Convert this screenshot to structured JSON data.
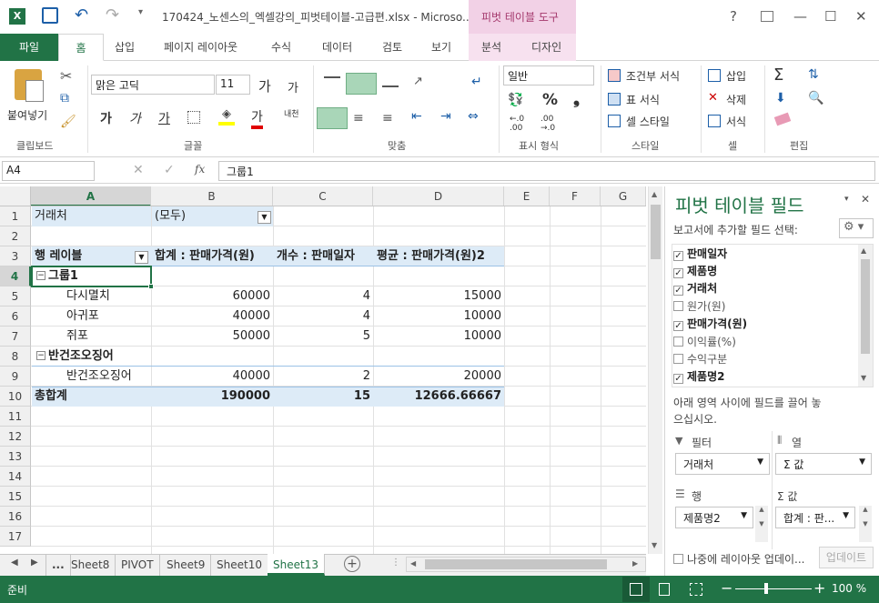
{
  "titlebar": {
    "title": "170424_노센스의_엑셀강의_피벗테이블-고급편.xlsx - Microso...",
    "context_group": "피벗 테이블 도구",
    "help": "?",
    "minimize": "—",
    "maximize": "☐",
    "close": "✕"
  },
  "ribbon_tabs": [
    "파일",
    "홈",
    "삽입",
    "페이지 레이아웃",
    "수식",
    "데이터",
    "검토",
    "보기",
    "분석",
    "디자인"
  ],
  "ribbon": {
    "clipboard": {
      "paste": "붙여넣기",
      "group": "클립보드"
    },
    "font": {
      "name": "맑은 고딕",
      "size": "11",
      "bold": "가",
      "italic": "가",
      "underline": "가",
      "grow": "가",
      "shrink": "가",
      "fontcolor": "가",
      "group": "글꼴",
      "phonetic": "내천"
    },
    "align": {
      "group": "맞춤"
    },
    "number": {
      "format": "일반",
      "group": "표시 형식",
      "percent": "%",
      "comma": "❟",
      "inc": "←.0\n.00",
      "dec": ".00\n→.0"
    },
    "styles": {
      "conditional": "조건부 서식",
      "table": "표 서식",
      "cell": "셀 스타일",
      "group": "스타일"
    },
    "cells": {
      "insert": "삽입",
      "delete": "삭제",
      "format": "서식",
      "group": "셀"
    },
    "editing": {
      "group": "편집"
    }
  },
  "formula_bar": {
    "name_box": "A4",
    "fx": "fx",
    "content": "그룹1"
  },
  "columns": [
    "A",
    "B",
    "C",
    "D",
    "E",
    "F",
    "G"
  ],
  "rows": [
    "1",
    "2",
    "3",
    "4",
    "5",
    "6",
    "7",
    "8",
    "9",
    "10",
    "11",
    "12",
    "13",
    "14",
    "15",
    "16",
    "17"
  ],
  "pivot": {
    "filter_label": "거래처",
    "filter_value": "(모두)",
    "headers": [
      "행 레이블",
      "합계 : 판매가격(원)",
      "개수 : 판매일자",
      "평균 : 판매가격(원)2"
    ],
    "group1": "그룹1",
    "group2": "반건조오징어",
    "rows": [
      {
        "label": "다시멸치",
        "sum": "60000",
        "count": "4",
        "avg": "15000"
      },
      {
        "label": "아귀포",
        "sum": "40000",
        "count": "4",
        "avg": "10000"
      },
      {
        "label": "쥐포",
        "sum": "50000",
        "count": "5",
        "avg": "10000"
      },
      {
        "label": "반건조오징어",
        "sum": "40000",
        "count": "2",
        "avg": "20000"
      }
    ],
    "total": {
      "label": "총합계",
      "sum": "190000",
      "count": "15",
      "avg": "12666.66667"
    }
  },
  "sheet_tabs": [
    "...",
    "Sheet8",
    "PIVOT",
    "Sheet9",
    "Sheet10",
    "Sheet13"
  ],
  "active_sheet": "Sheet13",
  "field_pane": {
    "title": "피벗 테이블 필드",
    "subtitle": "보고서에 추가할 필드 선택:",
    "fields": [
      {
        "name": "판매일자",
        "checked": true
      },
      {
        "name": "제품명",
        "checked": true
      },
      {
        "name": "거래처",
        "checked": true
      },
      {
        "name": "원가(원)",
        "checked": false
      },
      {
        "name": "판매가격(원)",
        "checked": true
      },
      {
        "name": "이익률(%)",
        "checked": false
      },
      {
        "name": "수익구분",
        "checked": false
      },
      {
        "name": "제품명2",
        "checked": true
      }
    ],
    "drag_hint": "아래 영역 사이에 필드를 끌어 놓으십시오.",
    "areas": {
      "filter_label": "필터",
      "filter_value": "거래처",
      "columns_label": "열",
      "columns_value": "Σ 값",
      "rows_label": "행",
      "rows_value": "제품명2",
      "values_label": "Σ 값",
      "values_value": "합계 : 판..."
    },
    "defer_label": "나중에 레이아웃 업데이...",
    "update_button": "업데이트"
  },
  "status": {
    "ready": "준비",
    "zoom": "100 %"
  },
  "colors": {
    "excel_green": "#217346",
    "pivot_header": "#ddebf7",
    "context_pink": "#f2d1e6"
  }
}
